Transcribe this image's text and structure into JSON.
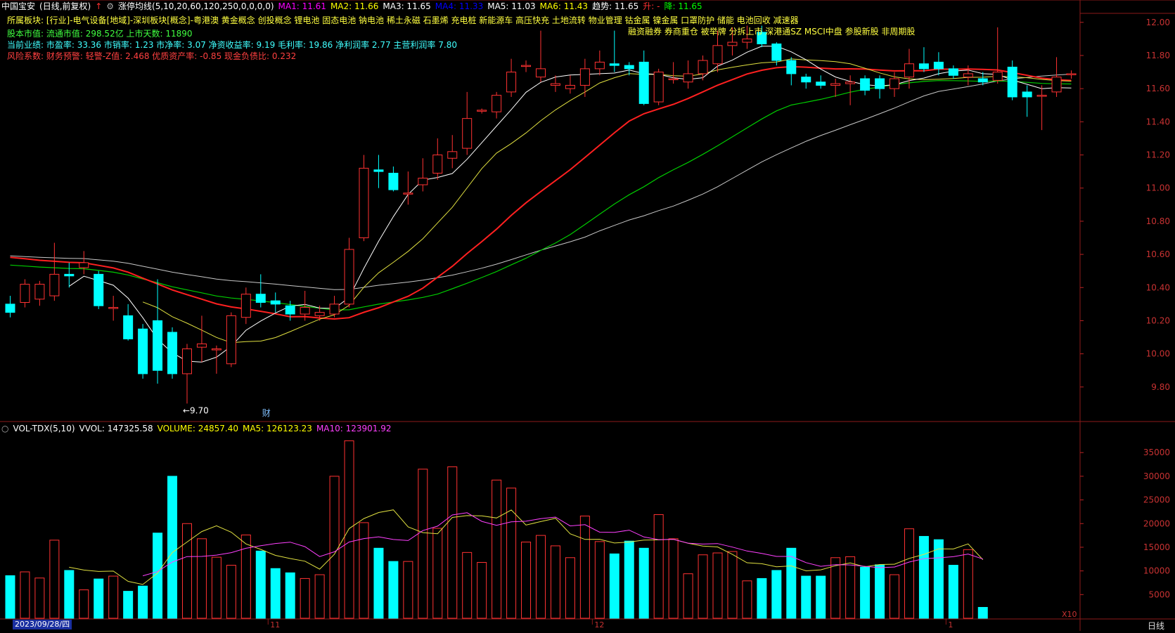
{
  "header": {
    "stock": "中国宝安",
    "mode": "(日线,前复权)",
    "indicator": "涨停均线(5,10,20,60,120,250,0,0,0,0)",
    "ma": [
      {
        "label": "MA1:",
        "value": "11.61",
        "color": "#ff00ff"
      },
      {
        "label": "MA2:",
        "value": "11.66",
        "color": "#ffff00"
      },
      {
        "label": "MA3:",
        "value": "11.65",
        "color": "#ffffff"
      },
      {
        "label": "MA4:",
        "value": "11.33",
        "color": "#0000ff"
      },
      {
        "label": "MA5:",
        "value": "11.03",
        "color": "#ffffff"
      },
      {
        "label": "MA6:",
        "value": "11.43",
        "color": "#ffff00"
      },
      {
        "label": "趋势:",
        "value": "11.65",
        "color": "#ffffff"
      },
      {
        "label": "升:",
        "value": "-",
        "color": "#ff3030"
      },
      {
        "label": "降:",
        "value": "11.65",
        "color": "#00ff00"
      }
    ]
  },
  "info": {
    "line1": "所属板块: [行业]-电气设备[地域]-深圳板块[概念]-粤港澳 黄金概念 创投概念 锂电池 固态电池 钠电池 稀土永磁 石墨烯 充电桩 新能源车 高压快充 土地流转 物业管理 钴金属 镍金属 口罩防护 储能 电池回收 减速器",
    "line1b": "融资融券 券商重仓 被举牌 分拆上市 深港通SZ MSCI中盘 参股新股 非周期股",
    "line2": "股本市值: 流通市值: 298.52亿 上市天数: 11890",
    "line3": "当前业绩: 市盈率: 33.36 市销率: 1.23 市净率: 3.07 净资收益率: 9.19 毛利率: 19.86 净利润率 2.77 主营利润率 7.80",
    "line4": "风险系数: 财务预警: 轻警-Z值: 2.468 优质资产率: -0.85 现金负债比: 0.232"
  },
  "annotations": {
    "low_marker": "←9.70",
    "fin_marker": "财"
  },
  "volume_header": {
    "name": "VOL-TDX(5,10)",
    "vvol": "VVOL: 147325.58",
    "volume": "VOLUME: 24857.40",
    "ma5": "MA5: 126123.23",
    "ma10": "MA10: 123901.92"
  },
  "bottom": {
    "date": "2023/09/28/四",
    "months": [
      "11",
      "12",
      "1"
    ],
    "x10": "X10",
    "period": "日线"
  },
  "chart_data": {
    "type": "candlestick",
    "price_axis": {
      "ticks": [
        "12.00",
        "11.80",
        "11.60",
        "11.40",
        "11.20",
        "11.00",
        "10.80",
        "10.60",
        "10.40",
        "10.20",
        "10.00",
        "9.80"
      ],
      "ylim": [
        9.6,
        12.05
      ]
    },
    "volume_axis": {
      "ticks": [
        "35000",
        "30000",
        "25000",
        "20000",
        "15000",
        "10000",
        "5000"
      ],
      "ylim": [
        0,
        38000
      ]
    },
    "candles": [
      [
        10.3,
        10.25,
        10.22,
        10.35
      ],
      [
        10.31,
        10.42,
        10.28,
        10.45
      ],
      [
        10.33,
        10.42,
        10.29,
        10.44
      ],
      [
        10.35,
        10.48,
        10.32,
        10.67
      ],
      [
        10.48,
        10.47,
        10.4,
        10.55
      ],
      [
        10.52,
        10.55,
        10.48,
        10.62
      ],
      [
        10.48,
        10.29,
        10.27,
        10.5
      ],
      [
        10.28,
        10.28,
        10.2,
        10.35
      ],
      [
        10.23,
        10.09,
        10.08,
        10.3
      ],
      [
        10.15,
        9.88,
        9.85,
        10.18
      ],
      [
        10.2,
        9.9,
        9.82,
        10.45
      ],
      [
        10.13,
        9.88,
        9.85,
        10.16
      ],
      [
        9.88,
        10.03,
        9.7,
        10.06
      ],
      [
        10.04,
        10.06,
        9.95,
        10.23
      ],
      [
        10.03,
        10.03,
        9.88,
        10.05
      ],
      [
        9.94,
        10.23,
        9.92,
        10.25
      ],
      [
        10.22,
        10.36,
        10.18,
        10.4
      ],
      [
        10.36,
        10.31,
        10.28,
        10.48
      ],
      [
        10.32,
        10.3,
        10.25,
        10.37
      ],
      [
        10.29,
        10.24,
        10.2,
        10.32
      ],
      [
        10.24,
        10.28,
        10.2,
        10.38
      ],
      [
        10.23,
        10.25,
        10.2,
        10.29
      ],
      [
        10.24,
        10.3,
        10.22,
        10.35
      ],
      [
        10.3,
        10.63,
        10.28,
        10.7
      ],
      [
        10.7,
        11.12,
        10.68,
        11.2
      ],
      [
        11.11,
        11.1,
        11.0,
        11.2
      ],
      [
        11.09,
        10.99,
        10.98,
        11.13
      ],
      [
        10.97,
        10.97,
        10.9,
        11.1
      ],
      [
        11.02,
        11.06,
        10.98,
        11.18
      ],
      [
        11.09,
        11.2,
        11.05,
        11.3
      ],
      [
        11.18,
        11.22,
        11.12,
        11.32
      ],
      [
        11.24,
        11.42,
        11.2,
        11.58
      ],
      [
        11.47,
        11.47,
        11.45,
        11.48
      ],
      [
        11.46,
        11.56,
        11.42,
        11.58
      ],
      [
        11.58,
        11.7,
        11.55,
        11.78
      ],
      [
        11.74,
        11.74,
        11.7,
        11.77
      ],
      [
        11.67,
        11.72,
        11.64,
        11.95
      ],
      [
        11.62,
        11.63,
        11.58,
        11.68
      ],
      [
        11.6,
        11.62,
        11.57,
        11.68
      ],
      [
        11.62,
        11.72,
        11.55,
        11.78
      ],
      [
        11.72,
        11.76,
        11.68,
        11.83
      ],
      [
        11.75,
        11.74,
        11.7,
        11.95
      ],
      [
        11.74,
        11.72,
        11.68,
        11.76
      ],
      [
        11.76,
        11.51,
        11.5,
        11.83
      ],
      [
        11.52,
        11.7,
        11.5,
        11.72
      ],
      [
        11.66,
        11.66,
        11.63,
        11.76
      ],
      [
        11.64,
        11.69,
        11.6,
        11.77
      ],
      [
        11.69,
        11.77,
        11.65,
        11.8
      ],
      [
        11.75,
        11.86,
        11.7,
        11.95
      ],
      [
        11.86,
        11.88,
        11.8,
        11.97
      ],
      [
        11.88,
        11.9,
        11.84,
        11.98
      ],
      [
        11.94,
        11.87,
        11.85,
        11.98
      ],
      [
        11.87,
        11.77,
        11.74,
        11.88
      ],
      [
        11.77,
        11.69,
        11.62,
        11.79
      ],
      [
        11.67,
        11.64,
        11.6,
        11.69
      ],
      [
        11.64,
        11.62,
        11.6,
        11.68
      ],
      [
        11.62,
        11.63,
        11.55,
        11.66
      ],
      [
        11.63,
        11.64,
        11.5,
        11.68
      ],
      [
        11.66,
        11.59,
        11.56,
        11.68
      ],
      [
        11.66,
        11.6,
        11.54,
        11.68
      ],
      [
        11.6,
        11.66,
        11.55,
        11.7
      ],
      [
        11.67,
        11.75,
        11.6,
        11.84
      ],
      [
        11.75,
        11.72,
        11.7,
        11.85
      ],
      [
        11.76,
        11.72,
        11.68,
        11.82
      ],
      [
        11.72,
        11.68,
        11.66,
        11.74
      ],
      [
        11.67,
        11.69,
        11.62,
        11.74
      ],
      [
        11.66,
        11.64,
        11.62,
        11.7
      ],
      [
        11.65,
        11.7,
        11.63,
        11.97
      ],
      [
        11.73,
        11.55,
        11.53,
        11.77
      ],
      [
        11.58,
        11.55,
        11.43,
        11.62
      ],
      [
        11.56,
        11.56,
        11.35,
        11.62
      ],
      [
        11.58,
        11.67,
        11.55,
        11.79
      ],
      [
        11.69,
        11.69,
        11.66,
        11.71
      ]
    ],
    "volumes": [
      9000,
      9800,
      8500,
      16500,
      10100,
      6000,
      8300,
      8900,
      5700,
      6800,
      18000,
      30000,
      20000,
      16800,
      12900,
      11200,
      17600,
      14200,
      10500,
      9600,
      8400,
      9200,
      30000,
      37500,
      20200,
      14800,
      12000,
      12000,
      31500,
      19000,
      32000,
      13900,
      11800,
      29200,
      27500,
      16100,
      17500,
      15300,
      12800,
      21600,
      16200,
      13600,
      16300,
      14800,
      21900,
      16800,
      9400,
      13400,
      13800,
      14100,
      7900,
      8400,
      10100,
      14800,
      8900,
      8900,
      12800,
      13000,
      10800,
      11300,
      9200,
      18900,
      17300,
      16600,
      11200,
      14500,
      2300
    ],
    "series": []
  }
}
